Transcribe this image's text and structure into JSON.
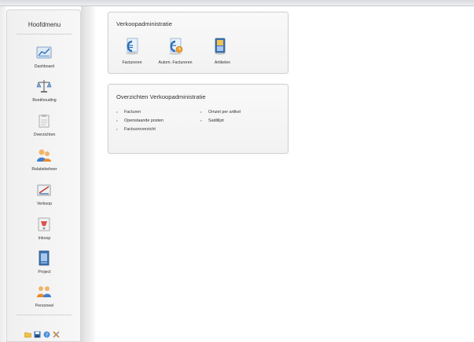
{
  "sidebar": {
    "title": "Hoofdmenu",
    "items": [
      {
        "label": "Dashboard",
        "icon": "dashboard-icon"
      },
      {
        "label": "Boekhouding",
        "icon": "bookkeeping-icon"
      },
      {
        "label": "Overzichten",
        "icon": "overview-icon"
      },
      {
        "label": "Relatiebeheer",
        "icon": "relations-icon"
      },
      {
        "label": "Verkoop",
        "icon": "sales-icon"
      },
      {
        "label": "Inkoop",
        "icon": "purchase-icon"
      },
      {
        "label": "Project",
        "icon": "project-icon"
      },
      {
        "label": "Personeel",
        "icon": "personnel-icon"
      }
    ],
    "bottom_icons": [
      "folder-icon",
      "save-icon",
      "help-icon",
      "tools-icon"
    ]
  },
  "sales_panel": {
    "title": "Verkoopadministratie",
    "tiles": [
      {
        "label": "Factureren",
        "icon": "invoice-icon"
      },
      {
        "label": "Autom. Factureren",
        "icon": "auto-invoice-icon"
      },
      {
        "label": "Artikelen",
        "icon": "articles-icon"
      }
    ]
  },
  "overview_panel": {
    "title": "Overzichten Verkoopadministratie",
    "links_left": [
      "Facturen",
      "Openstaande posten",
      "Factuuroverzicht"
    ],
    "links_right": [
      "Omzet per artikel",
      "Saldilijst"
    ]
  }
}
